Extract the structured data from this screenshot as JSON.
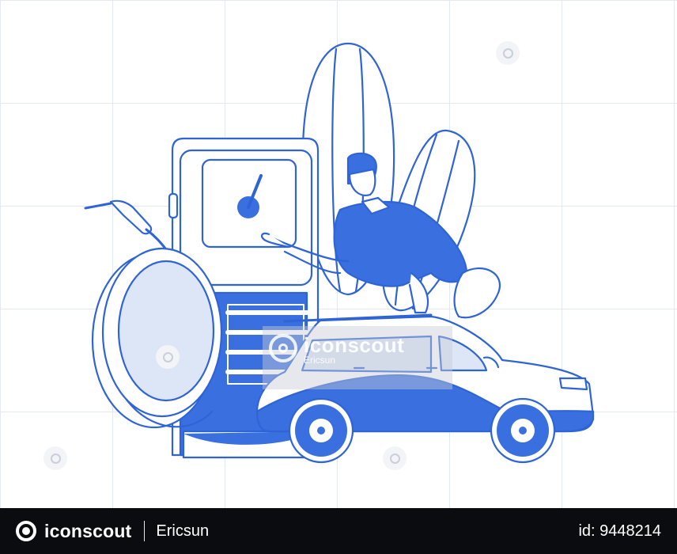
{
  "colors": {
    "primary": "#3a6fe0",
    "light": "#dde6f6",
    "outline": "#2f64d6",
    "footer_bg": "#0b0c0f"
  },
  "watermark": {
    "brand": "iconscout",
    "author": "Ericsun"
  },
  "footer": {
    "brand": "iconscout",
    "author": "Ericsun",
    "asset_id": "id: 9448214"
  },
  "icons": {
    "logo": "iconscout-logo-icon",
    "small_watermark": "watermark-logo-icon"
  }
}
